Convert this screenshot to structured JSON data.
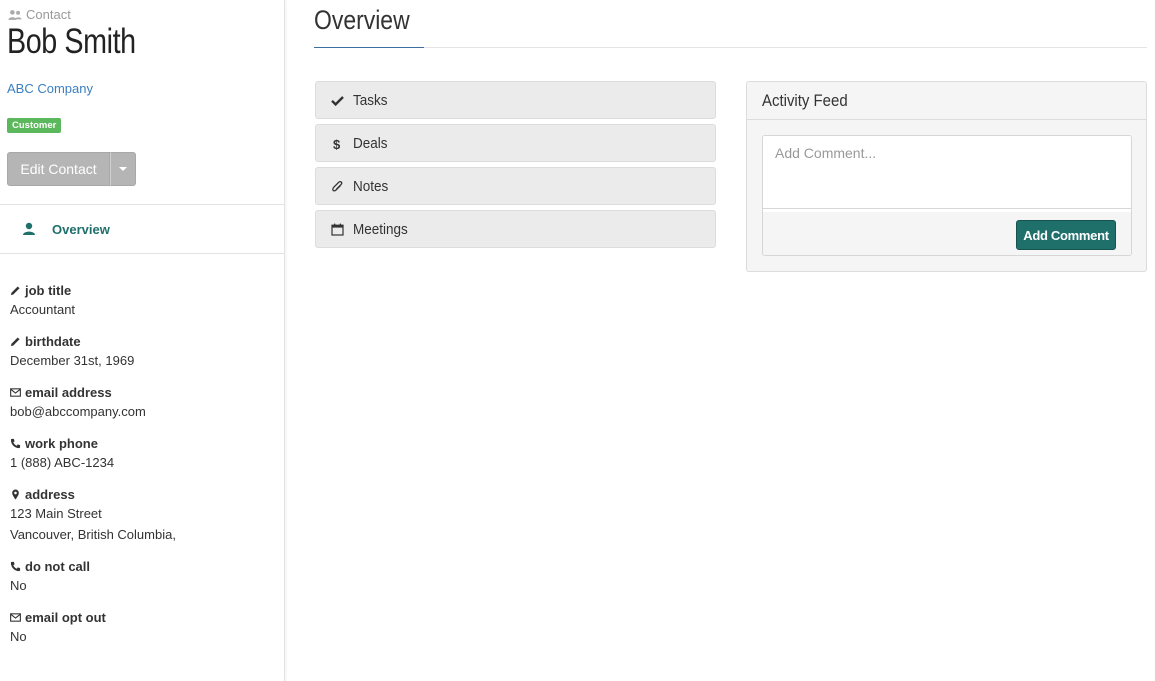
{
  "breadcrumb": {
    "icon": "users-icon",
    "label": "Contact"
  },
  "contact": {
    "name": "Bob Smith",
    "company": "ABC Company",
    "badge": "Customer",
    "edit_label": "Edit Contact"
  },
  "nav": {
    "overview": "Overview"
  },
  "fields": {
    "job_title": {
      "label": "job title",
      "value": "Accountant"
    },
    "birthdate": {
      "label": "birthdate",
      "value": "December 31st, 1969"
    },
    "email": {
      "label": "email address",
      "value": "bob@abccompany.com"
    },
    "work_phone": {
      "label": "work phone",
      "value": "1 (888) ABC-1234"
    },
    "address": {
      "label": "address",
      "line1": "123 Main Street",
      "line2": "Vancouver, British Columbia,"
    },
    "do_not_call": {
      "label": "do not call",
      "value": "No"
    },
    "email_opt_out": {
      "label": "email opt out",
      "value": "No"
    }
  },
  "main": {
    "title": "Overview",
    "panels": [
      {
        "label": "Tasks",
        "icon": "check-icon"
      },
      {
        "label": "Deals",
        "icon": "dollar-icon"
      },
      {
        "label": "Notes",
        "icon": "paperclip-icon"
      },
      {
        "label": "Meetings",
        "icon": "calendar-icon"
      }
    ]
  },
  "feed": {
    "title": "Activity Feed",
    "placeholder": "Add Comment...",
    "button": "Add Comment"
  },
  "colors": {
    "accent": "#1f6f6b",
    "link": "#3a7fc0",
    "badge": "#5cb85c"
  }
}
